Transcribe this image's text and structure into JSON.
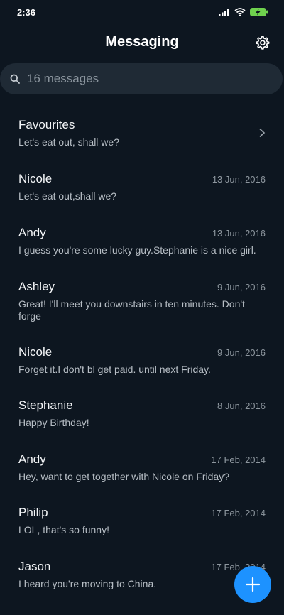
{
  "status_bar": {
    "time": "2:36",
    "icons": [
      "signal-icon",
      "wifi-icon",
      "battery-charging-icon"
    ],
    "battery_color": "#6fd24e"
  },
  "header": {
    "title": "Messaging",
    "settings_icon": "gear-icon"
  },
  "search": {
    "placeholder": "16 messages",
    "icon": "search-icon"
  },
  "conversations": [
    {
      "name": "Favourites",
      "preview": "Let's eat out, shall we?",
      "date": ""
    },
    {
      "name": "Nicole",
      "preview": "Let's eat out,shall we?",
      "date": "13 Jun, 2016"
    },
    {
      "name": "Andy",
      "preview": "I guess you're some lucky guy.Stephanie is a nice girl.",
      "date": "13 Jun, 2016"
    },
    {
      "name": "Ashley",
      "preview": "Great! I'll meet you downstairs in ten minutes. Don't forge",
      "date": "9 Jun, 2016"
    },
    {
      "name": "Nicole",
      "preview": "Forget it.I don't bl get paid. until next Friday.",
      "date": "9 Jun, 2016"
    },
    {
      "name": "Stephanie",
      "preview": "Happy Birthday!",
      "date": "8 Jun, 2016"
    },
    {
      "name": "Andy",
      "preview": "Hey, want to get together with Nicole on Friday?",
      "date": "17 Feb, 2014"
    },
    {
      "name": "Philip",
      "preview": "LOL, that's so funny!",
      "date": "17 Feb, 2014"
    },
    {
      "name": "Jason",
      "preview": "I heard you're moving to China.",
      "date": "17 Feb, 2014"
    }
  ],
  "fab": {
    "icon": "plus-icon",
    "color": "#1d92ff"
  },
  "colors": {
    "background": "#0d1620",
    "search_background": "#1f2a35"
  }
}
